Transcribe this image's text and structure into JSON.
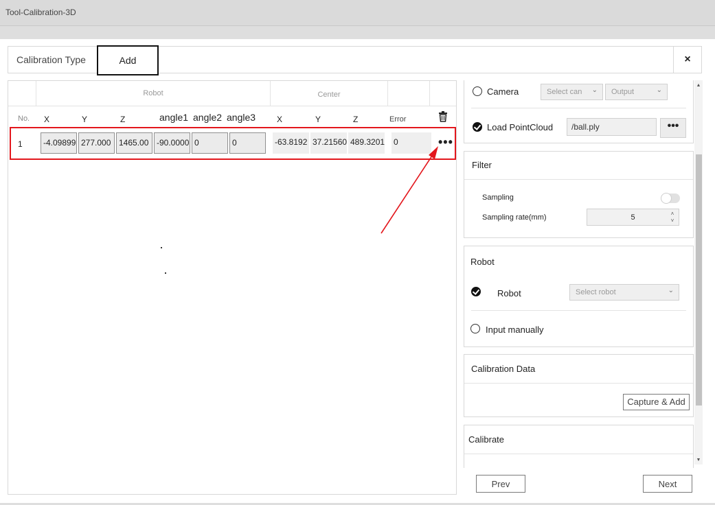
{
  "window": {
    "title": "Tool-Calibration-3D"
  },
  "tabs": {
    "calibration_type": "Calibration Type",
    "add": "Add",
    "close": "×"
  },
  "table": {
    "groups": {
      "robot": "Robot",
      "center": "Center"
    },
    "columns": {
      "no": "No.",
      "rx": "X",
      "ry": "Y",
      "rz": "Z",
      "a1": "angle1",
      "a2": "angle2",
      "a3": "angle3",
      "cx": "X",
      "cy": "Y",
      "cz": "Z",
      "error": "Error"
    },
    "row": {
      "no": "1",
      "rx": "-4.09899",
      "ry": "277.000",
      "rz": "1465.00",
      "a1": "-90.0000",
      "a2": "0",
      "a3": "0",
      "cx": "-63.8192",
      "cy": "37.21560",
      "cz": "489.3201",
      "error": "0",
      "more": "•••"
    }
  },
  "camera": {
    "label": "Camera",
    "select_placeholder": "Select can",
    "output_placeholder": "Output"
  },
  "pointcloud": {
    "label": "Load PointCloud",
    "path": "/ball.ply",
    "browse": "•••"
  },
  "filter": {
    "title": "Filter",
    "sampling": "Sampling",
    "sampling_enabled": false,
    "rate_label": "Sampling rate(mm)",
    "rate_value": "5"
  },
  "robot": {
    "title": "Robot",
    "robot_label": "Robot",
    "robot_placeholder": "Select robot",
    "manual_label": "Input manually"
  },
  "calib_data": {
    "title": "Calibration Data",
    "capture_add": "Capture & Add"
  },
  "calibrate": {
    "title": "Calibrate"
  },
  "nav": {
    "prev": "Prev",
    "next": "Next"
  },
  "colors": {
    "highlight": "#e3161c",
    "selected_tab_border": "#111111"
  }
}
